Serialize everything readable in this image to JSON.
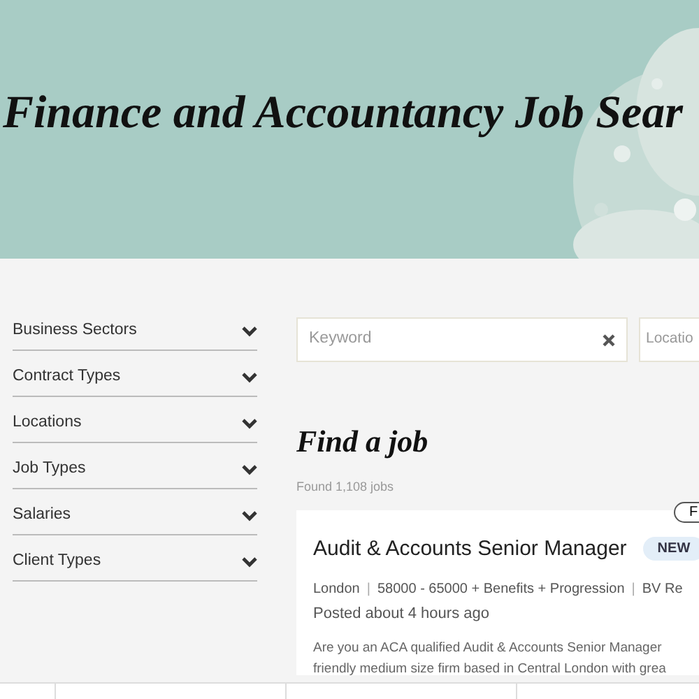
{
  "hero": {
    "title": "Finance and Accountancy Job Sear"
  },
  "filters": [
    {
      "label": "Business Sectors",
      "expanded": false
    },
    {
      "label": "Contract Types",
      "expanded": false
    },
    {
      "label": "Locations",
      "expanded": false
    },
    {
      "label": "Job Types",
      "expanded": false
    },
    {
      "label": "Salaries",
      "expanded": false
    },
    {
      "label": "Client Types",
      "expanded": false
    }
  ],
  "search": {
    "keyword_placeholder": "Keyword",
    "location_placeholder": "Locatio"
  },
  "heading": "Find a job",
  "result_count": "Found 1,108 jobs",
  "jobs": [
    {
      "tag": "F",
      "title": "Audit & Accounts Senior Manager",
      "badge": "NEW",
      "location": "London",
      "salary": "58000 - 65000 + Benefits + Progression",
      "company": "BV Re",
      "separator": "|",
      "posted": "Posted about 4 hours ago",
      "summary_lines": [
        "Are you an ACA qualified Audit & Accounts Senior Manager",
        "friendly medium size firm based in Central London with grea"
      ]
    }
  ]
}
